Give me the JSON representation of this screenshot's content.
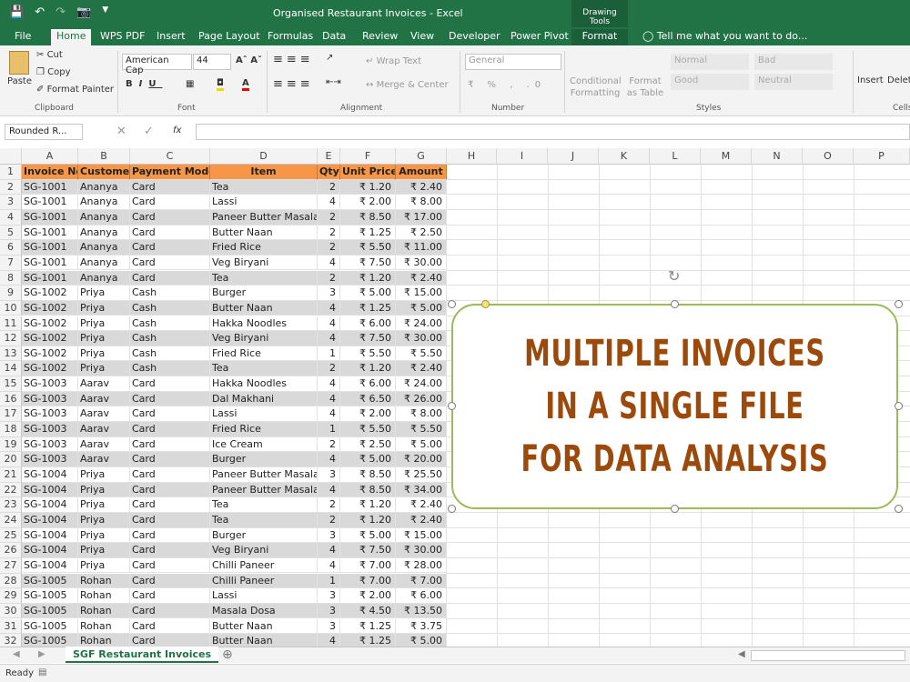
{
  "app": {
    "title": "Organised Restaurant Invoices - Excel",
    "contextual_group": "Drawing Tools",
    "tabs": [
      "File",
      "Home",
      "WPS PDF",
      "Insert",
      "Page Layout",
      "Formulas",
      "Data",
      "Review",
      "View",
      "Developer",
      "Power Pivot",
      "Format"
    ],
    "active_tab": "Home",
    "tell_me": "Tell me what you want to do..."
  },
  "ribbon": {
    "clipboard": {
      "paste": "Paste",
      "cut": "Cut",
      "copy": "Copy",
      "format_painter": "Format Painter",
      "label": "Clipboard"
    },
    "font": {
      "family": "American Cap",
      "size": "44",
      "label": "Font"
    },
    "alignment": {
      "wrap_text": "Wrap Text",
      "merge_center": "Merge & Center",
      "label": "Alignment"
    },
    "number": {
      "format": "General",
      "label": "Number"
    },
    "styles": {
      "conditional": "Conditional Formatting",
      "format_table": "Format as Table",
      "normal": "Normal",
      "bad": "Bad",
      "good": "Good",
      "neutral": "Neutral",
      "label": "Styles"
    },
    "cells": {
      "insert": "Insert",
      "delete": "Delet",
      "label": "Cells"
    }
  },
  "formula_bar": {
    "name_box": "Rounded R...",
    "fx": "fx",
    "value": ""
  },
  "columns": [
    "A",
    "B",
    "C",
    "D",
    "E",
    "F",
    "G",
    "H",
    "I",
    "J",
    "K",
    "L",
    "M",
    "N",
    "O",
    "P"
  ],
  "table": {
    "headers": [
      "Invoice No",
      "Customer",
      "Payment Mode",
      "Item",
      "Qty",
      "Unit Price",
      "Amount"
    ],
    "rows": [
      [
        "SG-1001",
        "Ananya",
        "Card",
        "Tea",
        "2",
        "₹ 1.20",
        "₹ 2.40"
      ],
      [
        "SG-1001",
        "Ananya",
        "Card",
        "Lassi",
        "4",
        "₹ 2.00",
        "₹ 8.00"
      ],
      [
        "SG-1001",
        "Ananya",
        "Card",
        "Paneer Butter Masala",
        "2",
        "₹ 8.50",
        "₹ 17.00"
      ],
      [
        "SG-1001",
        "Ananya",
        "Card",
        "Butter Naan",
        "2",
        "₹ 1.25",
        "₹ 2.50"
      ],
      [
        "SG-1001",
        "Ananya",
        "Card",
        "Fried Rice",
        "2",
        "₹ 5.50",
        "₹ 11.00"
      ],
      [
        "SG-1001",
        "Ananya",
        "Card",
        "Veg Biryani",
        "4",
        "₹ 7.50",
        "₹ 30.00"
      ],
      [
        "SG-1001",
        "Ananya",
        "Card",
        "Tea",
        "2",
        "₹ 1.20",
        "₹ 2.40"
      ],
      [
        "SG-1002",
        "Priya",
        "Cash",
        "Burger",
        "3",
        "₹ 5.00",
        "₹ 15.00"
      ],
      [
        "SG-1002",
        "Priya",
        "Cash",
        "Butter Naan",
        "4",
        "₹ 1.25",
        "₹ 5.00"
      ],
      [
        "SG-1002",
        "Priya",
        "Cash",
        "Hakka Noodles",
        "4",
        "₹ 6.00",
        "₹ 24.00"
      ],
      [
        "SG-1002",
        "Priya",
        "Cash",
        "Veg Biryani",
        "4",
        "₹ 7.50",
        "₹ 30.00"
      ],
      [
        "SG-1002",
        "Priya",
        "Cash",
        "Fried Rice",
        "1",
        "₹ 5.50",
        "₹ 5.50"
      ],
      [
        "SG-1002",
        "Priya",
        "Cash",
        "Tea",
        "2",
        "₹ 1.20",
        "₹ 2.40"
      ],
      [
        "SG-1003",
        "Aarav",
        "Card",
        "Hakka Noodles",
        "4",
        "₹ 6.00",
        "₹ 24.00"
      ],
      [
        "SG-1003",
        "Aarav",
        "Card",
        "Dal Makhani",
        "4",
        "₹ 6.50",
        "₹ 26.00"
      ],
      [
        "SG-1003",
        "Aarav",
        "Card",
        "Lassi",
        "4",
        "₹ 2.00",
        "₹ 8.00"
      ],
      [
        "SG-1003",
        "Aarav",
        "Card",
        "Fried Rice",
        "1",
        "₹ 5.50",
        "₹ 5.50"
      ],
      [
        "SG-1003",
        "Aarav",
        "Card",
        "Ice Cream",
        "2",
        "₹ 2.50",
        "₹ 5.00"
      ],
      [
        "SG-1003",
        "Aarav",
        "Card",
        "Burger",
        "4",
        "₹ 5.00",
        "₹ 20.00"
      ],
      [
        "SG-1004",
        "Priya",
        "Card",
        "Paneer Butter Masala",
        "3",
        "₹ 8.50",
        "₹ 25.50"
      ],
      [
        "SG-1004",
        "Priya",
        "Card",
        "Paneer Butter Masala",
        "4",
        "₹ 8.50",
        "₹ 34.00"
      ],
      [
        "SG-1004",
        "Priya",
        "Card",
        "Tea",
        "2",
        "₹ 1.20",
        "₹ 2.40"
      ],
      [
        "SG-1004",
        "Priya",
        "Card",
        "Tea",
        "2",
        "₹ 1.20",
        "₹ 2.40"
      ],
      [
        "SG-1004",
        "Priya",
        "Card",
        "Burger",
        "3",
        "₹ 5.00",
        "₹ 15.00"
      ],
      [
        "SG-1004",
        "Priya",
        "Card",
        "Veg Biryani",
        "4",
        "₹ 7.50",
        "₹ 30.00"
      ],
      [
        "SG-1004",
        "Priya",
        "Card",
        "Chilli Paneer",
        "4",
        "₹ 7.00",
        "₹ 28.00"
      ],
      [
        "SG-1005",
        "Rohan",
        "Card",
        "Chilli Paneer",
        "1",
        "₹ 7.00",
        "₹ 7.00"
      ],
      [
        "SG-1005",
        "Rohan",
        "Card",
        "Lassi",
        "3",
        "₹ 2.00",
        "₹ 6.00"
      ],
      [
        "SG-1005",
        "Rohan",
        "Card",
        "Masala Dosa",
        "3",
        "₹ 4.50",
        "₹ 13.50"
      ],
      [
        "SG-1005",
        "Rohan",
        "Card",
        "Butter Naan",
        "3",
        "₹ 1.25",
        "₹ 3.75"
      ],
      [
        "SG-1005",
        "Rohan",
        "Card",
        "Butter Naan",
        "4",
        "₹ 1.25",
        "₹ 5.00"
      ]
    ]
  },
  "shape": {
    "text": "MULTIPLE INVOICES IN A SINGLE FILE FOR DATA ANALYSIS",
    "text_color": "#9c4a0c",
    "border_color": "#9bbb59"
  },
  "sheet_tabs": {
    "active": "SGF Restaurant Invoices"
  },
  "status": {
    "text": "Ready"
  },
  "colors": {
    "brand": "#217346",
    "header_fill": "#f79646",
    "band_fill": "#d9d9d9"
  }
}
